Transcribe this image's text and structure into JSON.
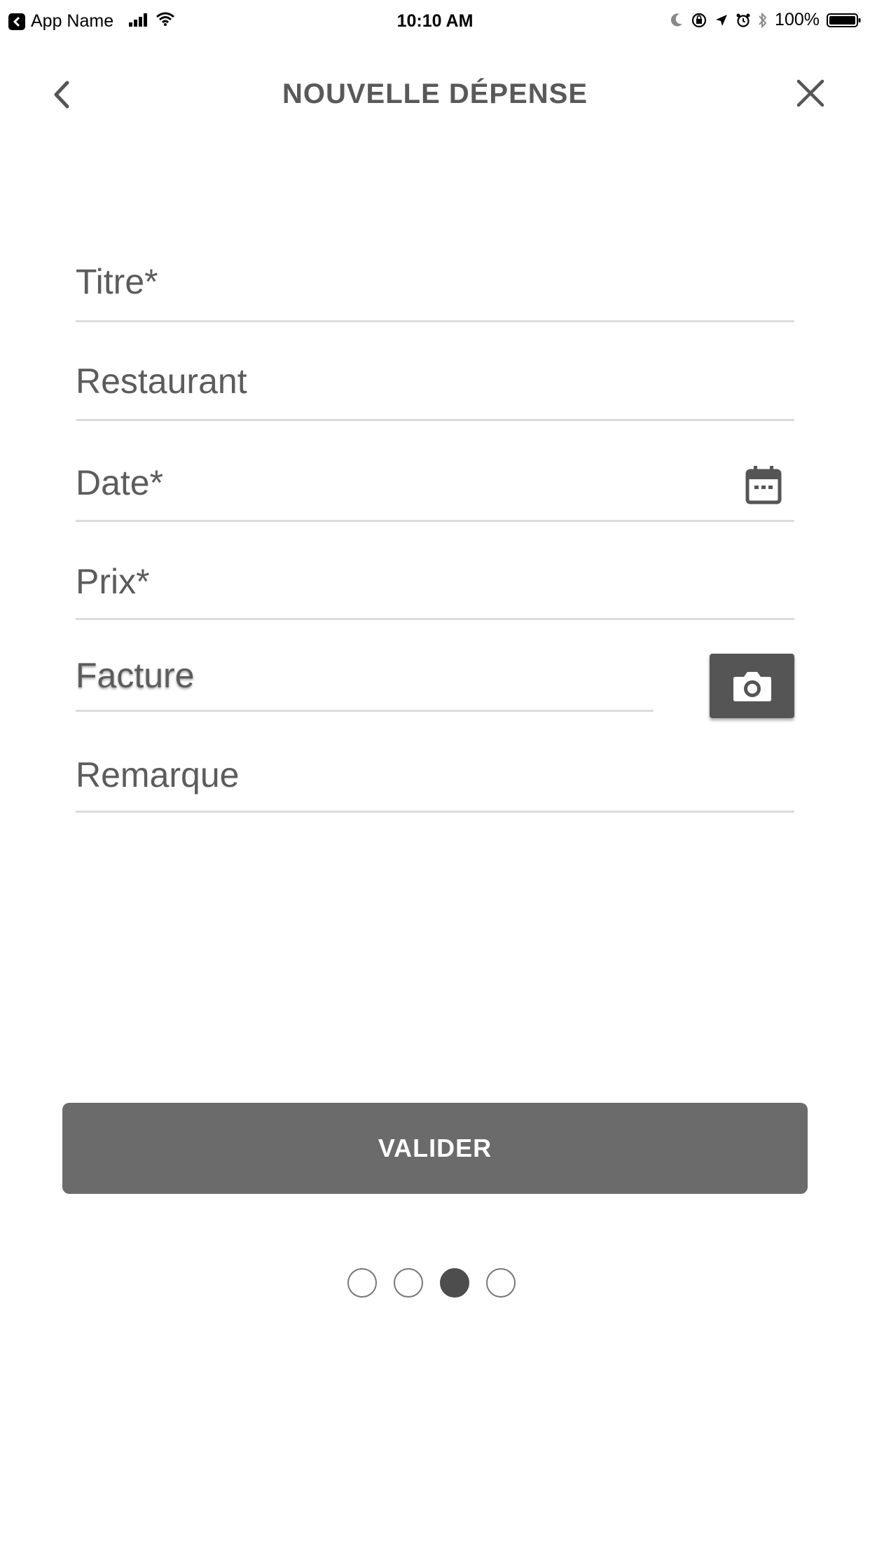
{
  "status_bar": {
    "app_name": "App Name",
    "time": "10:10 AM",
    "battery": "100%"
  },
  "nav": {
    "title": "NOUVELLE DÉPENSE"
  },
  "form": {
    "fields": [
      {
        "label": "Titre*"
      },
      {
        "label": "Restaurant"
      },
      {
        "label": "Date*"
      },
      {
        "label": "Prix*"
      },
      {
        "label": "Facture"
      },
      {
        "label": "Remarque"
      }
    ]
  },
  "submit": {
    "label": "VALIDER"
  },
  "pager": {
    "count": 4,
    "active_index": 2
  },
  "colors": {
    "text": "#595959",
    "button": "#6b6b6b",
    "camera_button": "#555555",
    "divider": "#dcdcdc"
  }
}
